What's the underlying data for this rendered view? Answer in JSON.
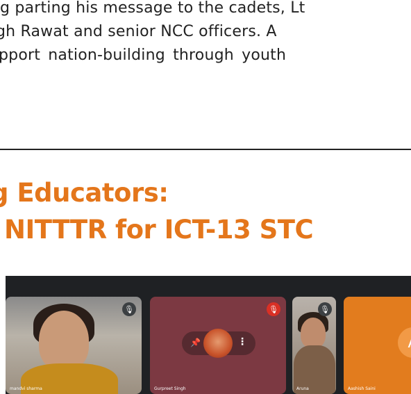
{
  "article": {
    "line1": "g parting his message to the cadets, Lt",
    "line2": "gh Rawat and senior NCC officers. A",
    "line3": "pport nation-building through youth"
  },
  "heading": {
    "line1": "g Educators:",
    "line2": "NITTTR for ICT-13 STC"
  },
  "colors": {
    "heading": "#e4761b",
    "meet_bg": "#1f2124",
    "tile_orange": "#e27c1e",
    "tile_maroon": "#7c3942"
  },
  "meeting": {
    "participants": [
      {
        "name": "mandvi sharma",
        "mic": "muted"
      },
      {
        "name": "Gurpreet Singh",
        "mic": "muted-red"
      },
      {
        "name": "Aruna",
        "mic": "muted"
      },
      {
        "name": "Aashish Saini",
        "avatar_letter": "A"
      }
    ]
  }
}
